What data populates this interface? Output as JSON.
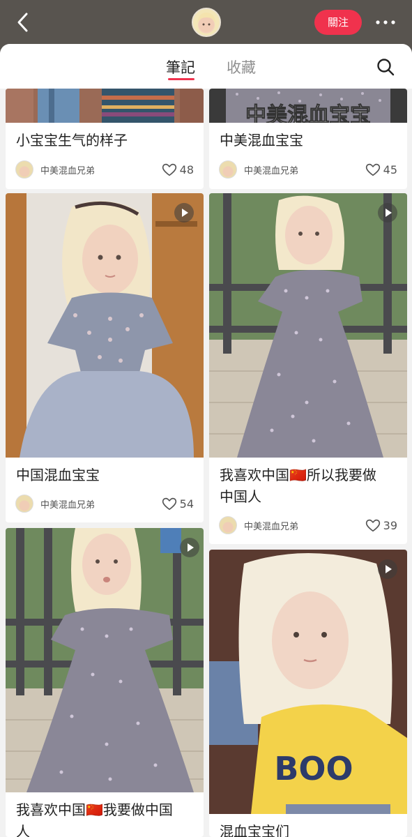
{
  "header": {
    "follow_label": "關注"
  },
  "tabs": {
    "notes": "筆記",
    "collections": "收藏"
  },
  "cards": [
    {
      "title_line1": "小宝宝生气的样子",
      "title_line2": "",
      "author": "中美混血兄弟",
      "likes": "48"
    },
    {
      "title_line1": "中美混血宝宝",
      "title_line2": "",
      "author": "中美混血兄弟",
      "likes": "45"
    },
    {
      "title_line1": "中国混血宝宝",
      "title_line2": "",
      "author": "中美混血兄弟",
      "likes": "54"
    },
    {
      "title_line1": "我喜欢中国🇨🇳所以我要做",
      "title_line2": "中国人",
      "author": "中美混血兄弟",
      "likes": "39"
    },
    {
      "title_line1": "我喜欢中国🇨🇳我要做中国",
      "title_line2": "人",
      "author": "",
      "likes": ""
    },
    {
      "title_line1": "混血宝宝们",
      "title_line2": "",
      "author": "",
      "likes": ""
    }
  ],
  "cover_overlay_text": "中美混血宝宝",
  "icons": {
    "back": "chevron-left-icon",
    "more": "more-dots-icon",
    "search": "search-icon",
    "play": "play-icon",
    "like": "heart-outline-icon"
  },
  "colors": {
    "accent": "#f0324d",
    "header_bg": "#58544f",
    "feed_bg": "#f2f2f2"
  }
}
